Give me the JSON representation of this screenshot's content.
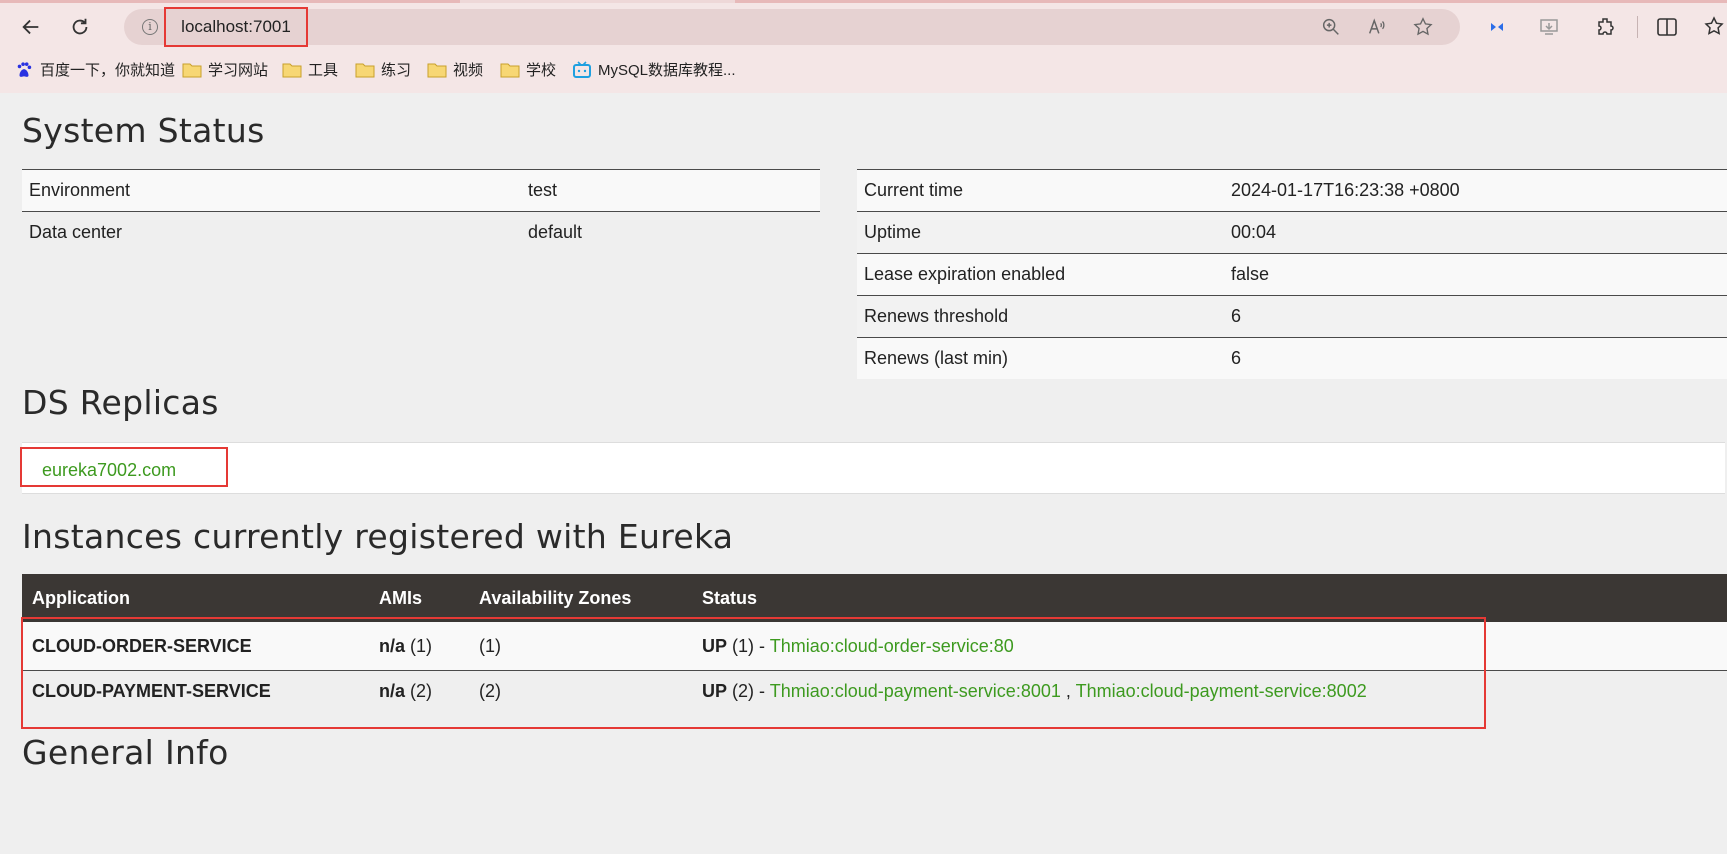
{
  "browser": {
    "url": "localhost:7001",
    "bookmarks": [
      {
        "label": "百度一下，你就知道",
        "icon": "baidu-paw-icon"
      },
      {
        "label": "学习网站",
        "icon": "folder-icon"
      },
      {
        "label": "工具",
        "icon": "folder-icon"
      },
      {
        "label": "练习",
        "icon": "folder-icon"
      },
      {
        "label": "视频",
        "icon": "folder-icon"
      },
      {
        "label": "学校",
        "icon": "folder-icon"
      },
      {
        "label": "MySQL数据库教程...",
        "icon": "bilibili-tv-icon"
      }
    ]
  },
  "system_status": {
    "title": "System Status",
    "left": [
      {
        "key": "Environment",
        "value": "test"
      },
      {
        "key": "Data center",
        "value": "default"
      }
    ],
    "right": [
      {
        "key": "Current time",
        "value": "2024-01-17T16:23:38 +0800"
      },
      {
        "key": "Uptime",
        "value": "00:04"
      },
      {
        "key": "Lease expiration enabled",
        "value": "false"
      },
      {
        "key": "Renews threshold",
        "value": "6"
      },
      {
        "key": "Renews (last min)",
        "value": "6"
      }
    ]
  },
  "replicas": {
    "title": "DS Replicas",
    "link": "eureka7002.com"
  },
  "instances": {
    "title": "Instances currently registered with Eureka",
    "headers": [
      "Application",
      "AMIs",
      "Availability Zones",
      "Status"
    ],
    "rows": [
      {
        "application": "CLOUD-ORDER-SERVICE",
        "ami_status": "n/a",
        "ami_count": "(1)",
        "zones": "(1)",
        "status": "UP",
        "status_count": "(1) -",
        "links": [
          "Thmiao:cloud-order-service:80"
        ]
      },
      {
        "application": "CLOUD-PAYMENT-SERVICE",
        "ami_status": "n/a",
        "ami_count": "(2)",
        "zones": "(2)",
        "status": "UP",
        "status_count": "(2) -",
        "links": [
          "Thmiao:cloud-payment-service:8001",
          "Thmiao:cloud-payment-service:8002"
        ],
        "link_separator": ","
      }
    ]
  },
  "general_info": {
    "title": "General Info"
  },
  "colors": {
    "link_green": "#3d9a1f",
    "header_dark": "#3b3734",
    "highlight_red": "#e53935",
    "chrome_pink": "#f4e6e6"
  }
}
